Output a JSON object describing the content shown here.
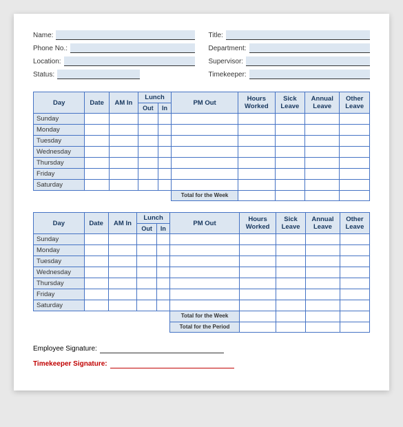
{
  "header": {
    "fields_left": [
      {
        "label": "Name:",
        "id": "name"
      },
      {
        "label": "Phone No.:",
        "id": "phone"
      },
      {
        "label": "Location:",
        "id": "location"
      },
      {
        "label": "Status:",
        "id": "status"
      }
    ],
    "fields_right": [
      {
        "label": "Title:",
        "id": "title"
      },
      {
        "label": "Department:",
        "id": "department"
      },
      {
        "label": "Supervisor:",
        "id": "supervisor"
      },
      {
        "label": "Timekeeper:",
        "id": "timekeeper"
      }
    ]
  },
  "table": {
    "columns": [
      "Day",
      "Date",
      "AM In",
      "Lunch",
      "PM Out",
      "Hours Worked",
      "Sick Leave",
      "Annual Leave",
      "Other Leave"
    ],
    "lunch_sub": [
      "Out",
      "In"
    ],
    "days": [
      "Sunday",
      "Monday",
      "Tuesday",
      "Wednesday",
      "Thursday",
      "Friday",
      "Saturday"
    ],
    "total_week_label": "Total for the Week",
    "total_period_label": "Total for the Period"
  },
  "signatures": {
    "employee_label": "Employee Signature:",
    "timekeeper_label": "Timekeeper Signature:"
  }
}
